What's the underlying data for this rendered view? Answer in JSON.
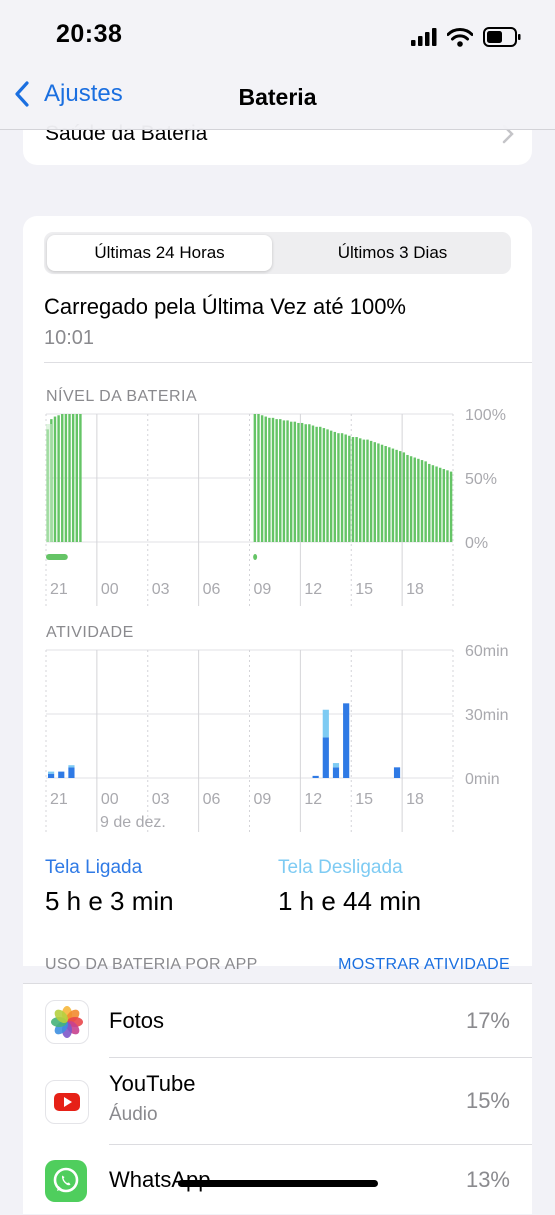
{
  "status_bar": {
    "time": "20:38"
  },
  "nav": {
    "back_label": "Ajustes",
    "title": "Bateria"
  },
  "health": {
    "label": "Saúde da Bateria"
  },
  "segments": {
    "active": "Últimas 24 Horas",
    "inactive": "Últimos 3 Dias"
  },
  "last_charge": {
    "text": "Carregado pela Última Vez até 100%",
    "time": "10:01"
  },
  "battery_chart": {
    "label": "NÍVEL DA BATERIA",
    "y_ticks": [
      "100%",
      "50%",
      "0%"
    ],
    "x_ticks": [
      "21",
      "00",
      "03",
      "06",
      "09",
      "12",
      "15",
      "18"
    ]
  },
  "activity_chart": {
    "label": "ATIVIDADE",
    "y_ticks": [
      "60min",
      "30min",
      "0min"
    ],
    "x_ticks": [
      "21",
      "00",
      "03",
      "06",
      "09",
      "12",
      "15",
      "18"
    ],
    "date_label": "9 de dez."
  },
  "chart_data": [
    {
      "type": "bar",
      "title": "NÍVEL DA BATERIA",
      "ylim": [
        0,
        100
      ],
      "y_unit": "%",
      "segments": [
        {
          "start_bar": 0,
          "values": [
            88,
            96,
            98,
            99,
            100,
            100,
            100,
            100,
            100,
            100
          ]
        },
        {
          "start_bar": 57,
          "values": [
            100,
            100,
            99,
            98,
            97,
            97,
            96,
            96,
            95,
            95,
            94,
            94,
            93,
            93,
            92,
            92,
            91,
            90,
            90,
            89,
            88,
            87,
            86,
            85,
            85,
            84,
            83,
            82,
            82,
            81,
            80,
            80,
            79,
            78,
            77,
            76,
            75,
            74,
            73,
            72,
            71,
            70,
            68,
            67,
            66,
            65,
            64,
            63,
            61,
            60,
            59,
            58,
            57,
            56,
            55
          ]
        }
      ],
      "total_bars": 112
    },
    {
      "type": "bar",
      "title": "ATIVIDADE",
      "ylim": [
        0,
        60
      ],
      "y_unit": "min",
      "series": [
        {
          "name": "Tela Ligada",
          "values": [
            2,
            3,
            5,
            0,
            0,
            0,
            0,
            0,
            0,
            0,
            0,
            0,
            0,
            0,
            0,
            0,
            0,
            0,
            0,
            0,
            0,
            0,
            0,
            0,
            0,
            0,
            1,
            19,
            5,
            35,
            0,
            0,
            0,
            0,
            5,
            0,
            0,
            0,
            0,
            0
          ]
        },
        {
          "name": "Tela Desligada",
          "values": [
            1,
            0,
            1,
            0,
            0,
            0,
            0,
            0,
            0,
            0,
            0,
            0,
            0,
            0,
            0,
            0,
            0,
            0,
            0,
            0,
            0,
            0,
            0,
            0,
            0,
            0,
            0,
            13,
            2,
            0,
            0,
            0,
            0,
            0,
            0,
            0,
            0,
            0,
            0,
            0
          ]
        }
      ]
    }
  ],
  "screen_time": {
    "on_label": "Tela Ligada",
    "on_value": "5 h e 3 min",
    "off_label": "Tela Desligada",
    "off_value": "1 h e 44 min"
  },
  "usage": {
    "header": "USO DA BATERIA POR APP",
    "link": "MOSTRAR ATIVIDADE",
    "apps": [
      {
        "name": "Fotos",
        "sub": "",
        "pct": "17%",
        "icon": "photos-icon"
      },
      {
        "name": "YouTube",
        "sub": "Áudio",
        "pct": "15%",
        "icon": "youtube-icon"
      },
      {
        "name": "WhatsApp",
        "sub": "",
        "pct": "13%",
        "icon": "whatsapp-icon"
      }
    ]
  },
  "colors": {
    "accent": "#1a6fe0",
    "battery_green": "#65c466",
    "screen_on": "#2f7ae5",
    "screen_off": "#7ecbf3",
    "background": "#f2f2f7"
  }
}
